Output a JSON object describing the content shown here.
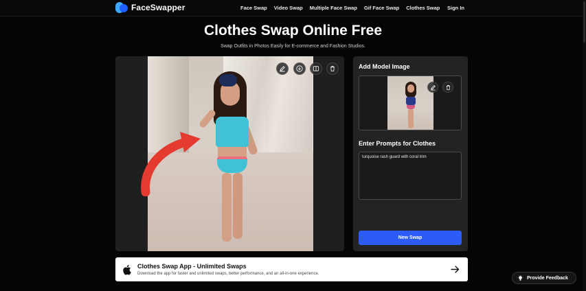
{
  "nav": {
    "brand": "FaceSwapper",
    "links": [
      "Face Swap",
      "Video Swap",
      "Multiple Face Swap",
      "Gif Face Swap",
      "Clothes Swap"
    ],
    "sign_in": "Sign In"
  },
  "hero": {
    "title": "Clothes Swap Online Free",
    "subtitle": "Swap Outfits in Photos Easily for E-commerce and Fashion Studios."
  },
  "editor": {
    "toolbar_icons": [
      "edit-icon",
      "download-icon",
      "compare-icon",
      "trash-icon"
    ],
    "annotation": "red-arrow"
  },
  "side_panel": {
    "model_label": "Add Model Image",
    "model_icons": [
      "edit-icon",
      "trash-icon"
    ],
    "prompt_label": "Enter Prompts for Clothes",
    "prompt_value": "turquoise rash guard with coral trim",
    "new_swap_label": "New Swap"
  },
  "banner": {
    "title": "Clothes Swap App - Unlimited Swaps",
    "subtitle": "Download the app for faster and unlimited swaps, better performance, and an all-in-one experience."
  },
  "feedback": {
    "label": "Provide  Feedback"
  },
  "colors": {
    "background": "#050505",
    "panel": "#232323",
    "accent": "#2c5cf5",
    "arrow": "#e53a2f"
  }
}
